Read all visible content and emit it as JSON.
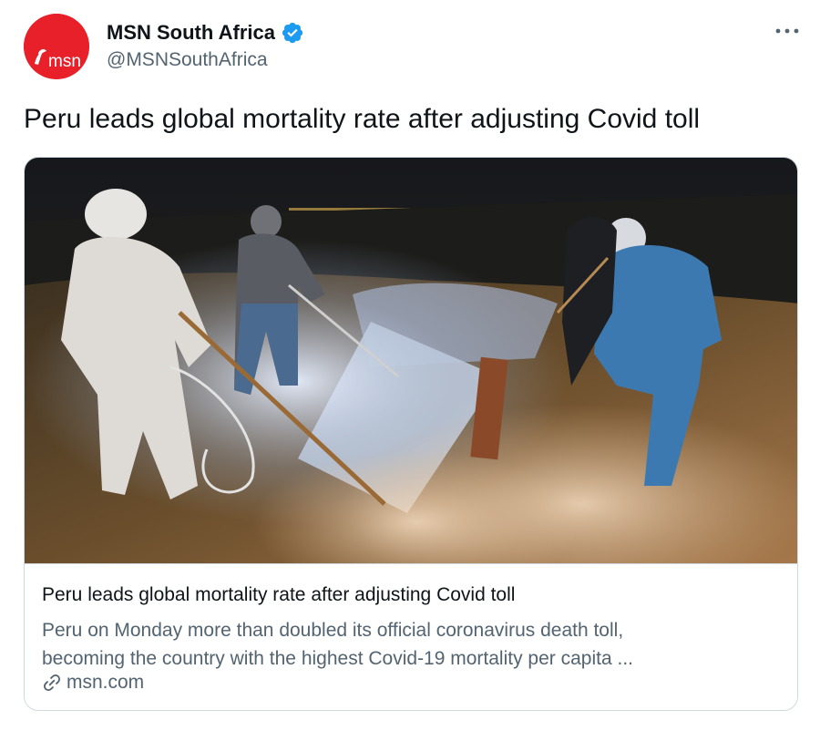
{
  "author": {
    "display_name": "MSN South Africa",
    "handle": "@MSNSouthAfrica",
    "avatar_text": "msn",
    "verified": true,
    "avatar_color": "#e8202a"
  },
  "tweet": {
    "text": "Peru leads global mortality rate after adjusting Covid toll"
  },
  "card": {
    "image_icon": "night-burial-scene-photo",
    "title": "Peru leads global mortality rate after adjusting Covid toll",
    "description_lines": [
      "Peru on Monday more than doubled its official coronavirus death toll,",
      "becoming the country with the highest Covid-19 mortality per capita ..."
    ],
    "domain": "msn.com",
    "link_icon": "link-icon"
  },
  "icons": {
    "more": "more-icon",
    "verified": "verified-badge-icon"
  },
  "colors": {
    "verified_blue": "#1d9bf0",
    "secondary_text": "#536471",
    "border": "#cfd9de"
  }
}
